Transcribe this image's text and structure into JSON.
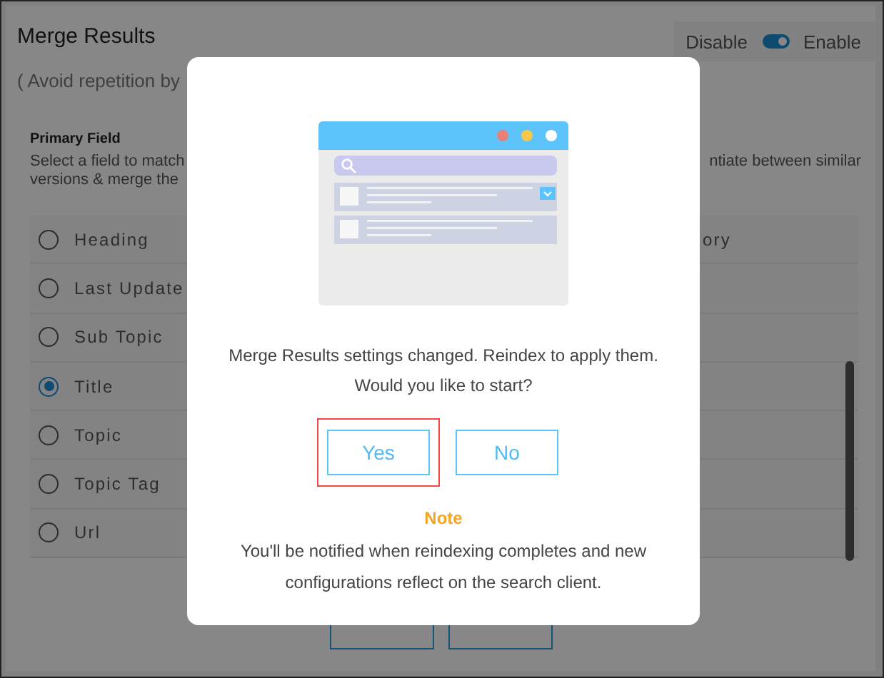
{
  "header": {
    "title": "Merge Results",
    "subtitle": "( Avoid repetition by",
    "toggle": {
      "off_label": "Disable",
      "on_label": "Enable",
      "on": true
    }
  },
  "primary_field": {
    "title": "Primary Field",
    "description_left": [
      "Select a field to match",
      "versions & merge the"
    ],
    "description_right": "ntiate between similar"
  },
  "fields": [
    {
      "label": "Heading",
      "selected": false,
      "column_2": "ory"
    },
    {
      "label": "Last Update",
      "selected": false
    },
    {
      "label": "Sub Topic",
      "selected": false
    },
    {
      "label": "Title",
      "selected": true
    },
    {
      "label": "Topic",
      "selected": false
    },
    {
      "label": "Topic Tag",
      "selected": false
    },
    {
      "label": "Url",
      "selected": false
    }
  ],
  "footer_buttons": [
    {
      "kind": "outline"
    },
    {
      "kind": "outline"
    }
  ],
  "dialog": {
    "message": [
      "Merge Results settings changed. Reindex to apply them.",
      "Would you like to start?"
    ],
    "buttons": [
      {
        "label": "Yes",
        "highlighted": true
      },
      {
        "label": "No",
        "highlighted": false
      }
    ],
    "note_title": "Note",
    "note": "You'll be notified when reindexing completes and new configurations reflect on the search client."
  }
}
